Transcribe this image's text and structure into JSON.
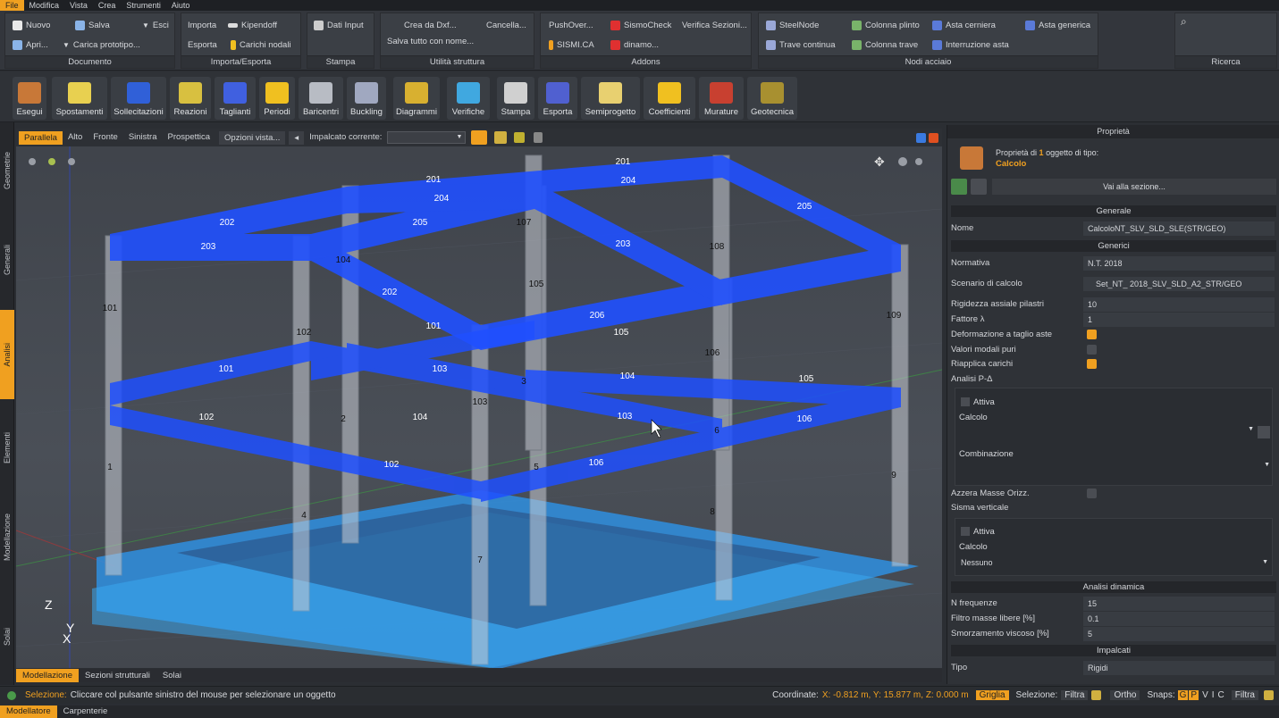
{
  "menu": [
    "File",
    "Modifica",
    "Vista",
    "Crea",
    "Strumenti",
    "Aiuto"
  ],
  "ribbon": {
    "documento": {
      "label": "Documento",
      "items": [
        "Nuovo",
        "Salva",
        "Esci",
        "Apri...",
        "Carica prototipo..."
      ]
    },
    "importa": {
      "label": "Importa/Esporta",
      "items": [
        "Importa",
        "Kipendoff",
        "Esporta",
        "Carichi nodali"
      ]
    },
    "stampa": {
      "label": "Stampa",
      "items": [
        "Dati Input"
      ]
    },
    "utilita": {
      "label": "Utilità struttura",
      "items": [
        "Crea da Dxf...",
        "Cancella...",
        "Salva tutto con nome..."
      ]
    },
    "addons": {
      "label": "Addons",
      "items": [
        "PushOver...",
        "SismoCheck",
        "Verifica Sezioni...",
        "SISMI.CA",
        "dinamo..."
      ]
    },
    "nodi": {
      "label": "Nodi acciaio",
      "items": [
        "SteelNode",
        "Colonna plinto",
        "Asta cerniera",
        "Asta generica",
        "Trave continua",
        "Colonna trave",
        "Interruzione asta"
      ]
    },
    "ricerca": {
      "label": "Ricerca"
    }
  },
  "tools": [
    "Esegui",
    "Spostamenti",
    "Sollecitazioni",
    "Reazioni",
    "Taglianti",
    "Periodi",
    "Baricentri",
    "Buckling",
    "Diagrammi",
    "Verifiche",
    "Stampa",
    "Esporta",
    "Semiprogetto",
    "Coefficienti",
    "Murature",
    "Geotecnica"
  ],
  "lefttabs": [
    "Geometrie",
    "Generali",
    "Analisi",
    "Elementi",
    "Modellazione",
    "Solai"
  ],
  "viewtabs": [
    "Parallela",
    "Alto",
    "Fronte",
    "Sinistra",
    "Prospettica"
  ],
  "view_options": "Opzioni vista...",
  "impalcato_label": "Impalcato corrente:",
  "axes": {
    "z": "Z",
    "y": "Y",
    "x": "X"
  },
  "scene_labels": {
    "beams": [
      "201",
      "202",
      "203",
      "204",
      "205",
      "201",
      "202",
      "203",
      "204",
      "205",
      "206",
      "101",
      "102",
      "103",
      "104",
      "105",
      "106",
      "101",
      "102",
      "103",
      "104",
      "105",
      "106"
    ],
    "columns": [
      "101",
      "102",
      "103",
      "104",
      "105",
      "106",
      "107",
      "108",
      "109",
      "1",
      "2",
      "3",
      "4",
      "5",
      "6",
      "7",
      "8",
      "9"
    ]
  },
  "bottomtabs": [
    "Modellazione",
    "Sezioni strutturali",
    "Solai"
  ],
  "status": {
    "label": "Selezione:",
    "text": "Cliccare col pulsante sinistro del mouse per selezionare un oggetto",
    "coords_label": "Coordinate:",
    "coords": "X: -0.812 m, Y: 15.877 m, Z: 0.000 m",
    "griglia": "Griglia",
    "selezione": "Selezione:",
    "filtra": "Filtra",
    "ortho": "Ortho",
    "snaps": "Snaps:",
    "snapkeys": [
      "G",
      "P",
      "V",
      "I",
      "C"
    ],
    "filtra2": "Filtra"
  },
  "modetabs": [
    "Modellatore",
    "Carpenterie"
  ],
  "panel": {
    "title": "Proprietà",
    "header_a": "Proprietà di",
    "header_n": "1",
    "header_b": "oggetto di tipo:",
    "header_type": "Calcolo",
    "goto": "Vai alla sezione...",
    "sec_generale": "Generale",
    "nome_label": "Nome",
    "nome_value": "CalcoloNT_SLV_SLD_SLE(STR/GEO)",
    "sec_generici": "Generici",
    "normativa_label": "Normativa",
    "normativa_value": "N.T. 2018",
    "scenario_label": "Scenario di calcolo",
    "scenario_value": "Set_NT_ 2018_SLV_SLD_A2_STR/GEO",
    "rig_label": "Rigidezza assiale pilastri",
    "rig_value": "10",
    "fattore_label": "Fattore λ",
    "fattore_value": "1",
    "def_label": "Deformazione a taglio aste",
    "val_label": "Valori modali puri",
    "riap_label": "Riapplica carichi",
    "pdelta_label": "Analisi P-Δ",
    "attiva1": "Attiva",
    "calcolo1": "Calcolo",
    "combinazione": "Combinazione",
    "azzera_label": "Azzera Masse Orizz.",
    "sisma_label": "Sisma verticale",
    "attiva2": "Attiva",
    "calcolo2": "Calcolo",
    "nessuno": "Nessuno",
    "sec_dinamica": "Analisi dinamica",
    "nfreq_label": "N frequenze",
    "nfreq_value": "15",
    "filtro_label": "Filtro masse libere [%]",
    "filtro_value": "0.1",
    "smorz_label": "Smorzamento viscoso [%]",
    "smorz_value": "5",
    "sec_impalcati": "Impalcati",
    "tipo_label": "Tipo",
    "tipo_value": "Rigidi"
  }
}
